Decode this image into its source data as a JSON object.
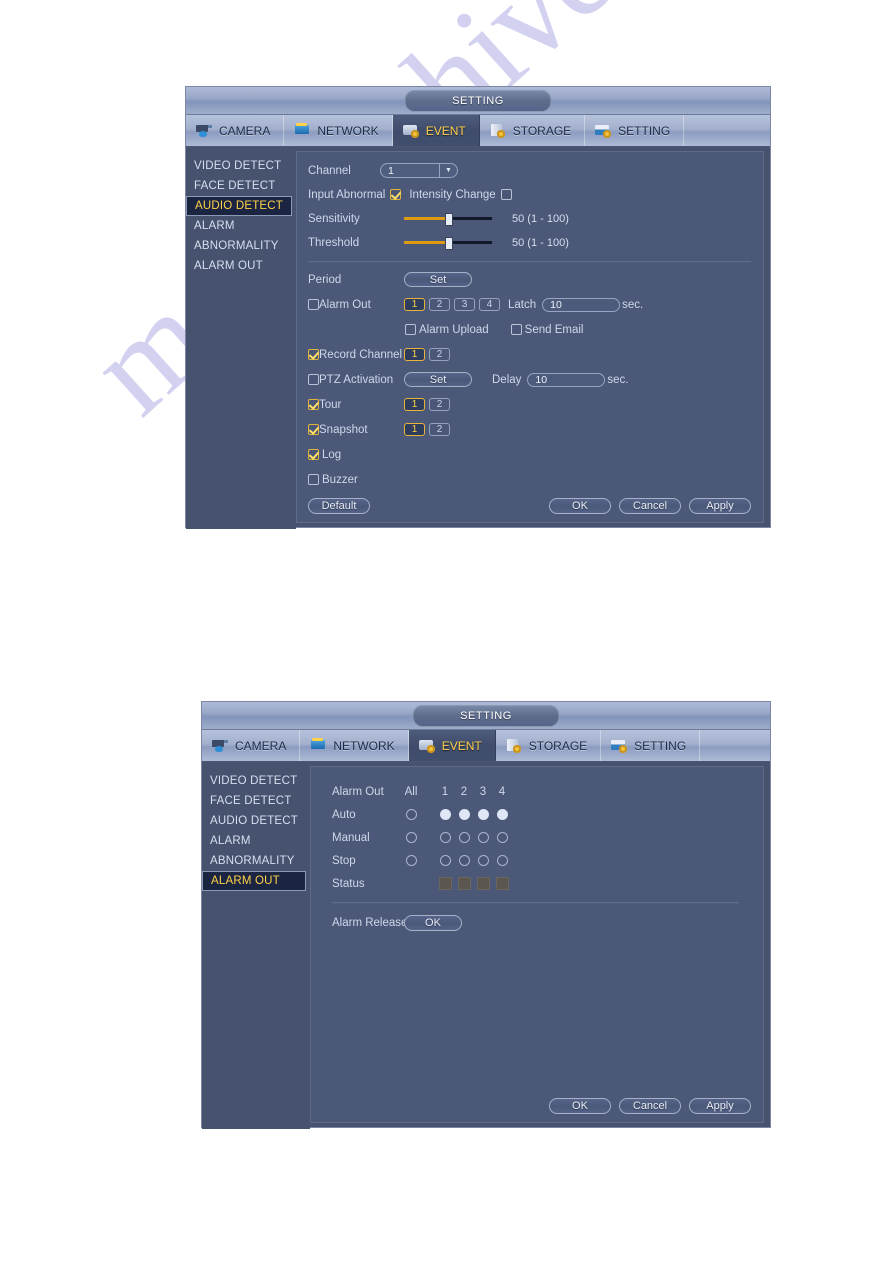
{
  "watermark": "manualshive.com",
  "panels": [
    {
      "id": "audio-detect",
      "title": "SETTING",
      "tabs": [
        {
          "label": "CAMERA",
          "icon": "camera-icon",
          "active": false
        },
        {
          "label": "NETWORK",
          "icon": "network-icon",
          "active": false
        },
        {
          "label": "EVENT",
          "icon": "event-icon",
          "active": true
        },
        {
          "label": "STORAGE",
          "icon": "storage-icon",
          "active": false
        },
        {
          "label": "SETTING",
          "icon": "setting-icon",
          "active": false
        }
      ],
      "sidebar": [
        {
          "label": "VIDEO DETECT",
          "active": false
        },
        {
          "label": "FACE DETECT",
          "active": false
        },
        {
          "label": "AUDIO DETECT",
          "active": true
        },
        {
          "label": "ALARM",
          "active": false
        },
        {
          "label": "ABNORMALITY",
          "active": false
        },
        {
          "label": "ALARM OUT",
          "active": false
        }
      ],
      "form": {
        "channel_label": "Channel",
        "channel_value": "1",
        "input_abnormal_label": "Input Abnormal",
        "input_abnormal_checked": true,
        "intensity_change_label": "Intensity Change",
        "intensity_change_checked": false,
        "sensitivity_label": "Sensitivity",
        "sensitivity_value": "50 (1 - 100)",
        "sensitivity_percent": 50,
        "threshold_label": "Threshold",
        "threshold_value": "50 (1 - 100)",
        "threshold_percent": 50,
        "period_label": "Period",
        "period_button": "Set",
        "alarm_out_label": "Alarm Out",
        "alarm_out_checked": false,
        "alarm_out_chips": [
          "1",
          "2",
          "3",
          "4"
        ],
        "alarm_out_selected": "1",
        "latch_label": "Latch",
        "latch_value": "10",
        "latch_unit": "sec.",
        "alarm_upload_label": "Alarm Upload",
        "alarm_upload_checked": false,
        "send_email_label": "Send Email",
        "send_email_checked": false,
        "record_channel_label": "Record Channel",
        "record_channel_checked": true,
        "record_channel_chips": [
          "1",
          "2"
        ],
        "record_channel_selected": "1",
        "ptz_activation_label": "PTZ Activation",
        "ptz_activation_checked": false,
        "ptz_button": "Set",
        "delay_label": "Delay",
        "delay_value": "10",
        "delay_unit": "sec.",
        "tour_label": "Tour",
        "tour_checked": true,
        "tour_chips": [
          "1",
          "2"
        ],
        "tour_selected": "1",
        "snapshot_label": "Snapshot",
        "snapshot_checked": true,
        "snapshot_chips": [
          "1",
          "2"
        ],
        "snapshot_selected": "1",
        "log_label": "Log",
        "log_checked": true,
        "buzzer_label": "Buzzer",
        "buzzer_checked": false
      },
      "footer": {
        "default_label": "Default",
        "ok_label": "OK",
        "cancel_label": "Cancel",
        "apply_label": "Apply"
      }
    },
    {
      "id": "alarm-out",
      "title": "SETTING",
      "tabs": [
        {
          "label": "CAMERA",
          "icon": "camera-icon",
          "active": false
        },
        {
          "label": "NETWORK",
          "icon": "network-icon",
          "active": false
        },
        {
          "label": "EVENT",
          "icon": "event-icon",
          "active": true
        },
        {
          "label": "STORAGE",
          "icon": "storage-icon",
          "active": false
        },
        {
          "label": "SETTING",
          "icon": "setting-icon",
          "active": false
        }
      ],
      "sidebar": [
        {
          "label": "VIDEO DETECT",
          "active": false
        },
        {
          "label": "FACE DETECT",
          "active": false
        },
        {
          "label": "AUDIO DETECT",
          "active": false
        },
        {
          "label": "ALARM",
          "active": false
        },
        {
          "label": "ABNORMALITY",
          "active": false
        },
        {
          "label": "ALARM OUT",
          "active": true
        }
      ],
      "form": {
        "header_label": "Alarm Out",
        "col_all": "All",
        "columns": [
          "1",
          "2",
          "3",
          "4"
        ],
        "rows": [
          {
            "label": "Auto",
            "all": false,
            "channels": [
              true,
              true,
              true,
              true
            ]
          },
          {
            "label": "Manual",
            "all": false,
            "channels": [
              false,
              false,
              false,
              false
            ]
          },
          {
            "label": "Stop",
            "all": false,
            "channels": [
              false,
              false,
              false,
              false
            ]
          }
        ],
        "status_label": "Status",
        "status_count": 4,
        "alarm_release_label": "Alarm Release",
        "alarm_release_button": "OK"
      },
      "footer": {
        "ok_label": "OK",
        "cancel_label": "Cancel",
        "apply_label": "Apply"
      }
    }
  ]
}
